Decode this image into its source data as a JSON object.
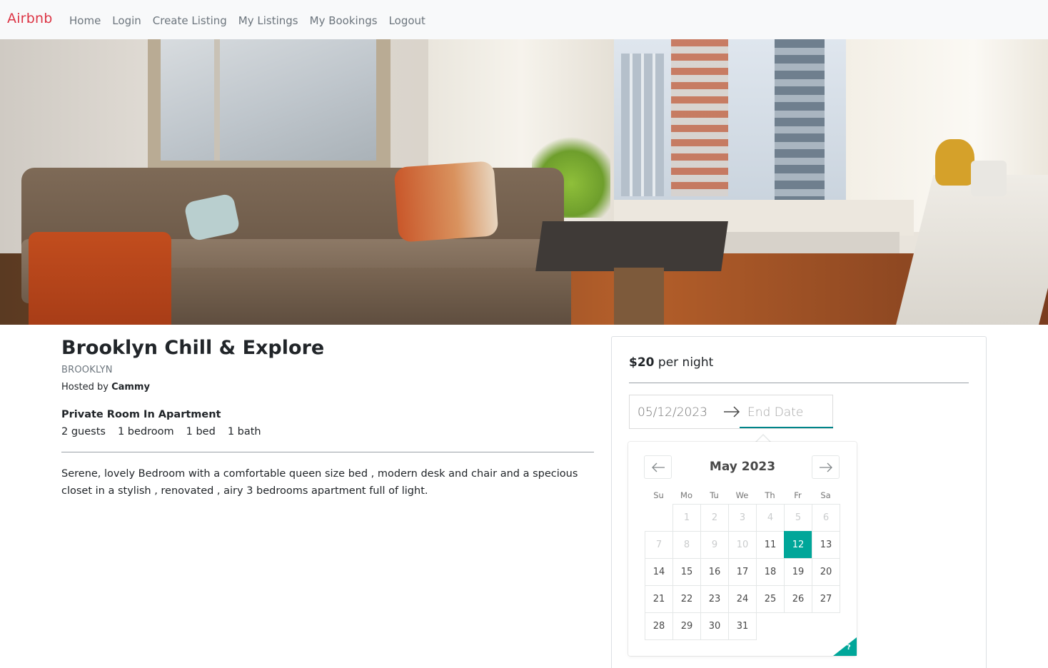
{
  "nav": {
    "brand": "Airbnb",
    "links": [
      "Home",
      "Login",
      "Create Listing",
      "My Listings",
      "My Bookings",
      "Logout"
    ],
    "brand_color": "#dc3545"
  },
  "listing": {
    "title": "Brooklyn Chill & Explore",
    "city": "BROOKLYN",
    "hosted_prefix": "Hosted by",
    "host": "Cammy",
    "room_type": "Private Room In Apartment",
    "features": [
      "2 guests",
      "1 bedroom",
      "1 bed",
      "1 bath"
    ],
    "description": "Serene, lovely Bedroom with a comfortable queen size bed , modern desk and chair and a specious closet in a stylish , renovated , airy 3 bedrooms apartment full of light."
  },
  "booking": {
    "price": "$20",
    "price_suffix": "per night",
    "start_date": "05/12/2023",
    "end_date_placeholder": "End Date",
    "calendar": {
      "month": "May 2023",
      "weekdays": [
        "Su",
        "Mo",
        "Tu",
        "We",
        "Th",
        "Fr",
        "Sa"
      ],
      "first_weekday_index": 1,
      "days_in_month": 31,
      "blocked_through": 10,
      "selected_day": 12,
      "help_badge": "?",
      "accent_color": "#00a699"
    }
  },
  "icons": {
    "range_arrow": "arrow-right-icon",
    "prev": "arrow-left-icon",
    "next": "arrow-right-icon"
  }
}
